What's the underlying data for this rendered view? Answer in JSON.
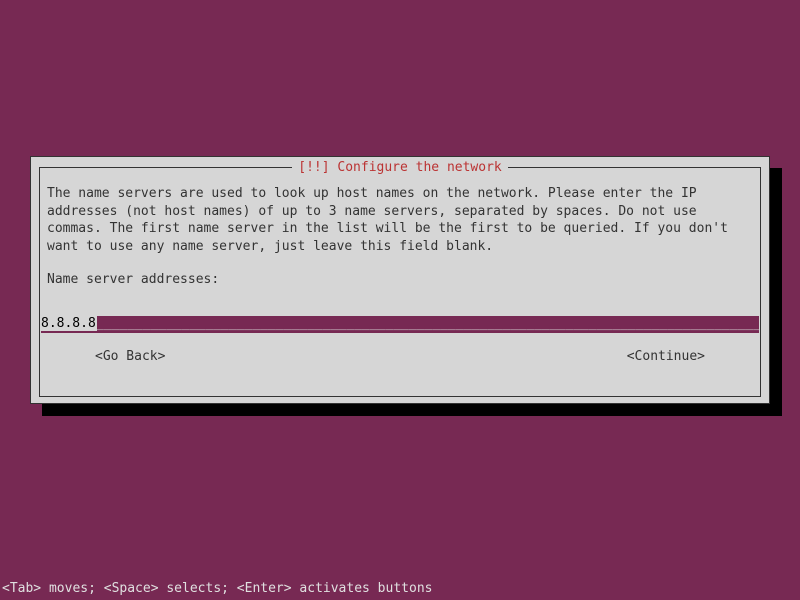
{
  "title": "[!!] Configure the network",
  "description": "The name servers are used to look up host names on the network. Please enter the IP addresses (not host names) of up to 3 name servers, separated by spaces. Do not use commas. The first name server in the list will be the first to be queried. If you don't want to use any name server, just leave this field blank.",
  "prompt_label": "Name server addresses:",
  "input_value": "8.8.8.8",
  "go_back_label": "<Go Back>",
  "continue_label": "<Continue>",
  "hint_line": "<Tab> moves; <Space> selects; <Enter> activates buttons"
}
